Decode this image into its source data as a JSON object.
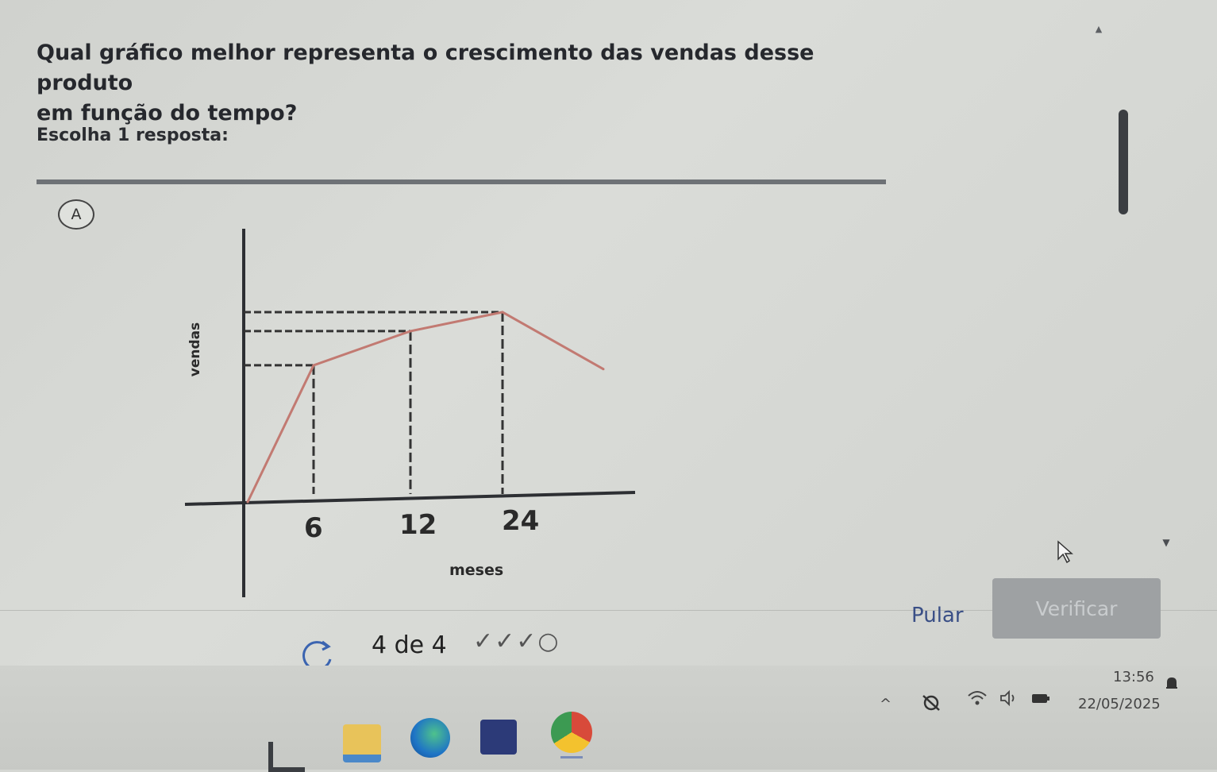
{
  "question": {
    "line1": "Qual gráfico melhor representa o crescimento das vendas desse produto",
    "line2": "em função do tempo?"
  },
  "instruction": "Escolha 1 resposta:",
  "option": {
    "letter": "A"
  },
  "chart_data": {
    "type": "line",
    "xlabel": "meses",
    "ylabel": "vendas",
    "x_ticks": [
      "6",
      "12",
      "24"
    ],
    "x": [
      0,
      6,
      12,
      24,
      30
    ],
    "y": [
      0,
      0.72,
      0.9,
      1.0,
      0.7
    ],
    "series_color": "#c27a72",
    "guides": "dashed"
  },
  "footer": {
    "progress": "4 de 4",
    "progress_marks": "✓✓✓○",
    "skip_label": "Pular",
    "verify_label": "Verificar"
  },
  "system": {
    "time": "13:56",
    "date": "22/05/2025"
  },
  "colors": {
    "accent_link": "#3a4f86",
    "verify_disabled": "#9ea1a3"
  }
}
